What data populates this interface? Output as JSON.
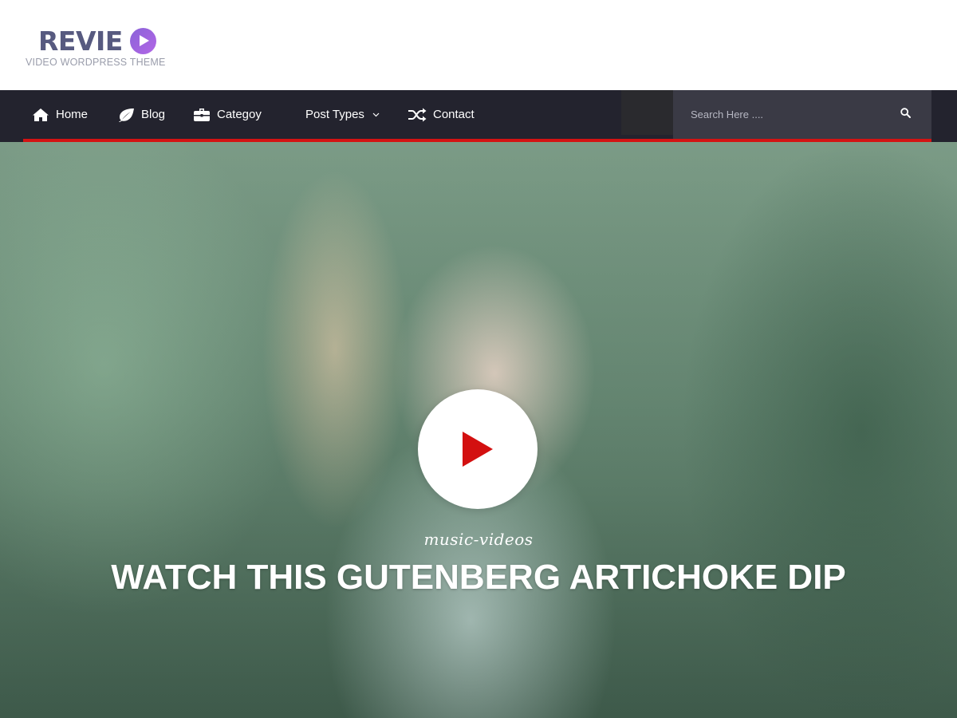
{
  "logo": {
    "wordmark": "REVIE",
    "tagline": "VIDEO WORDPRESS THEME",
    "play_icon": "play-circle-icon",
    "accent_color": "#a064e0"
  },
  "nav": {
    "items": [
      {
        "label": "Home",
        "icon": "home-icon"
      },
      {
        "label": "Blog",
        "icon": "leaf-icon"
      },
      {
        "label": "Categoy",
        "icon": "briefcase-icon"
      },
      {
        "label": "Post Types",
        "icon": "chevron-down-icon"
      },
      {
        "label": "Contact",
        "icon": "shuffle-icon"
      }
    ],
    "accent_color": "#d31313",
    "background_color": "#23232e"
  },
  "search": {
    "placeholder": "Search Here ....",
    "button_icon": "search-icon"
  },
  "hero": {
    "category": "music-videos",
    "title": "WATCH THIS GUTENBERG ARTICHOKE DIP",
    "play_icon": "play-icon",
    "play_color": "#d31010"
  }
}
